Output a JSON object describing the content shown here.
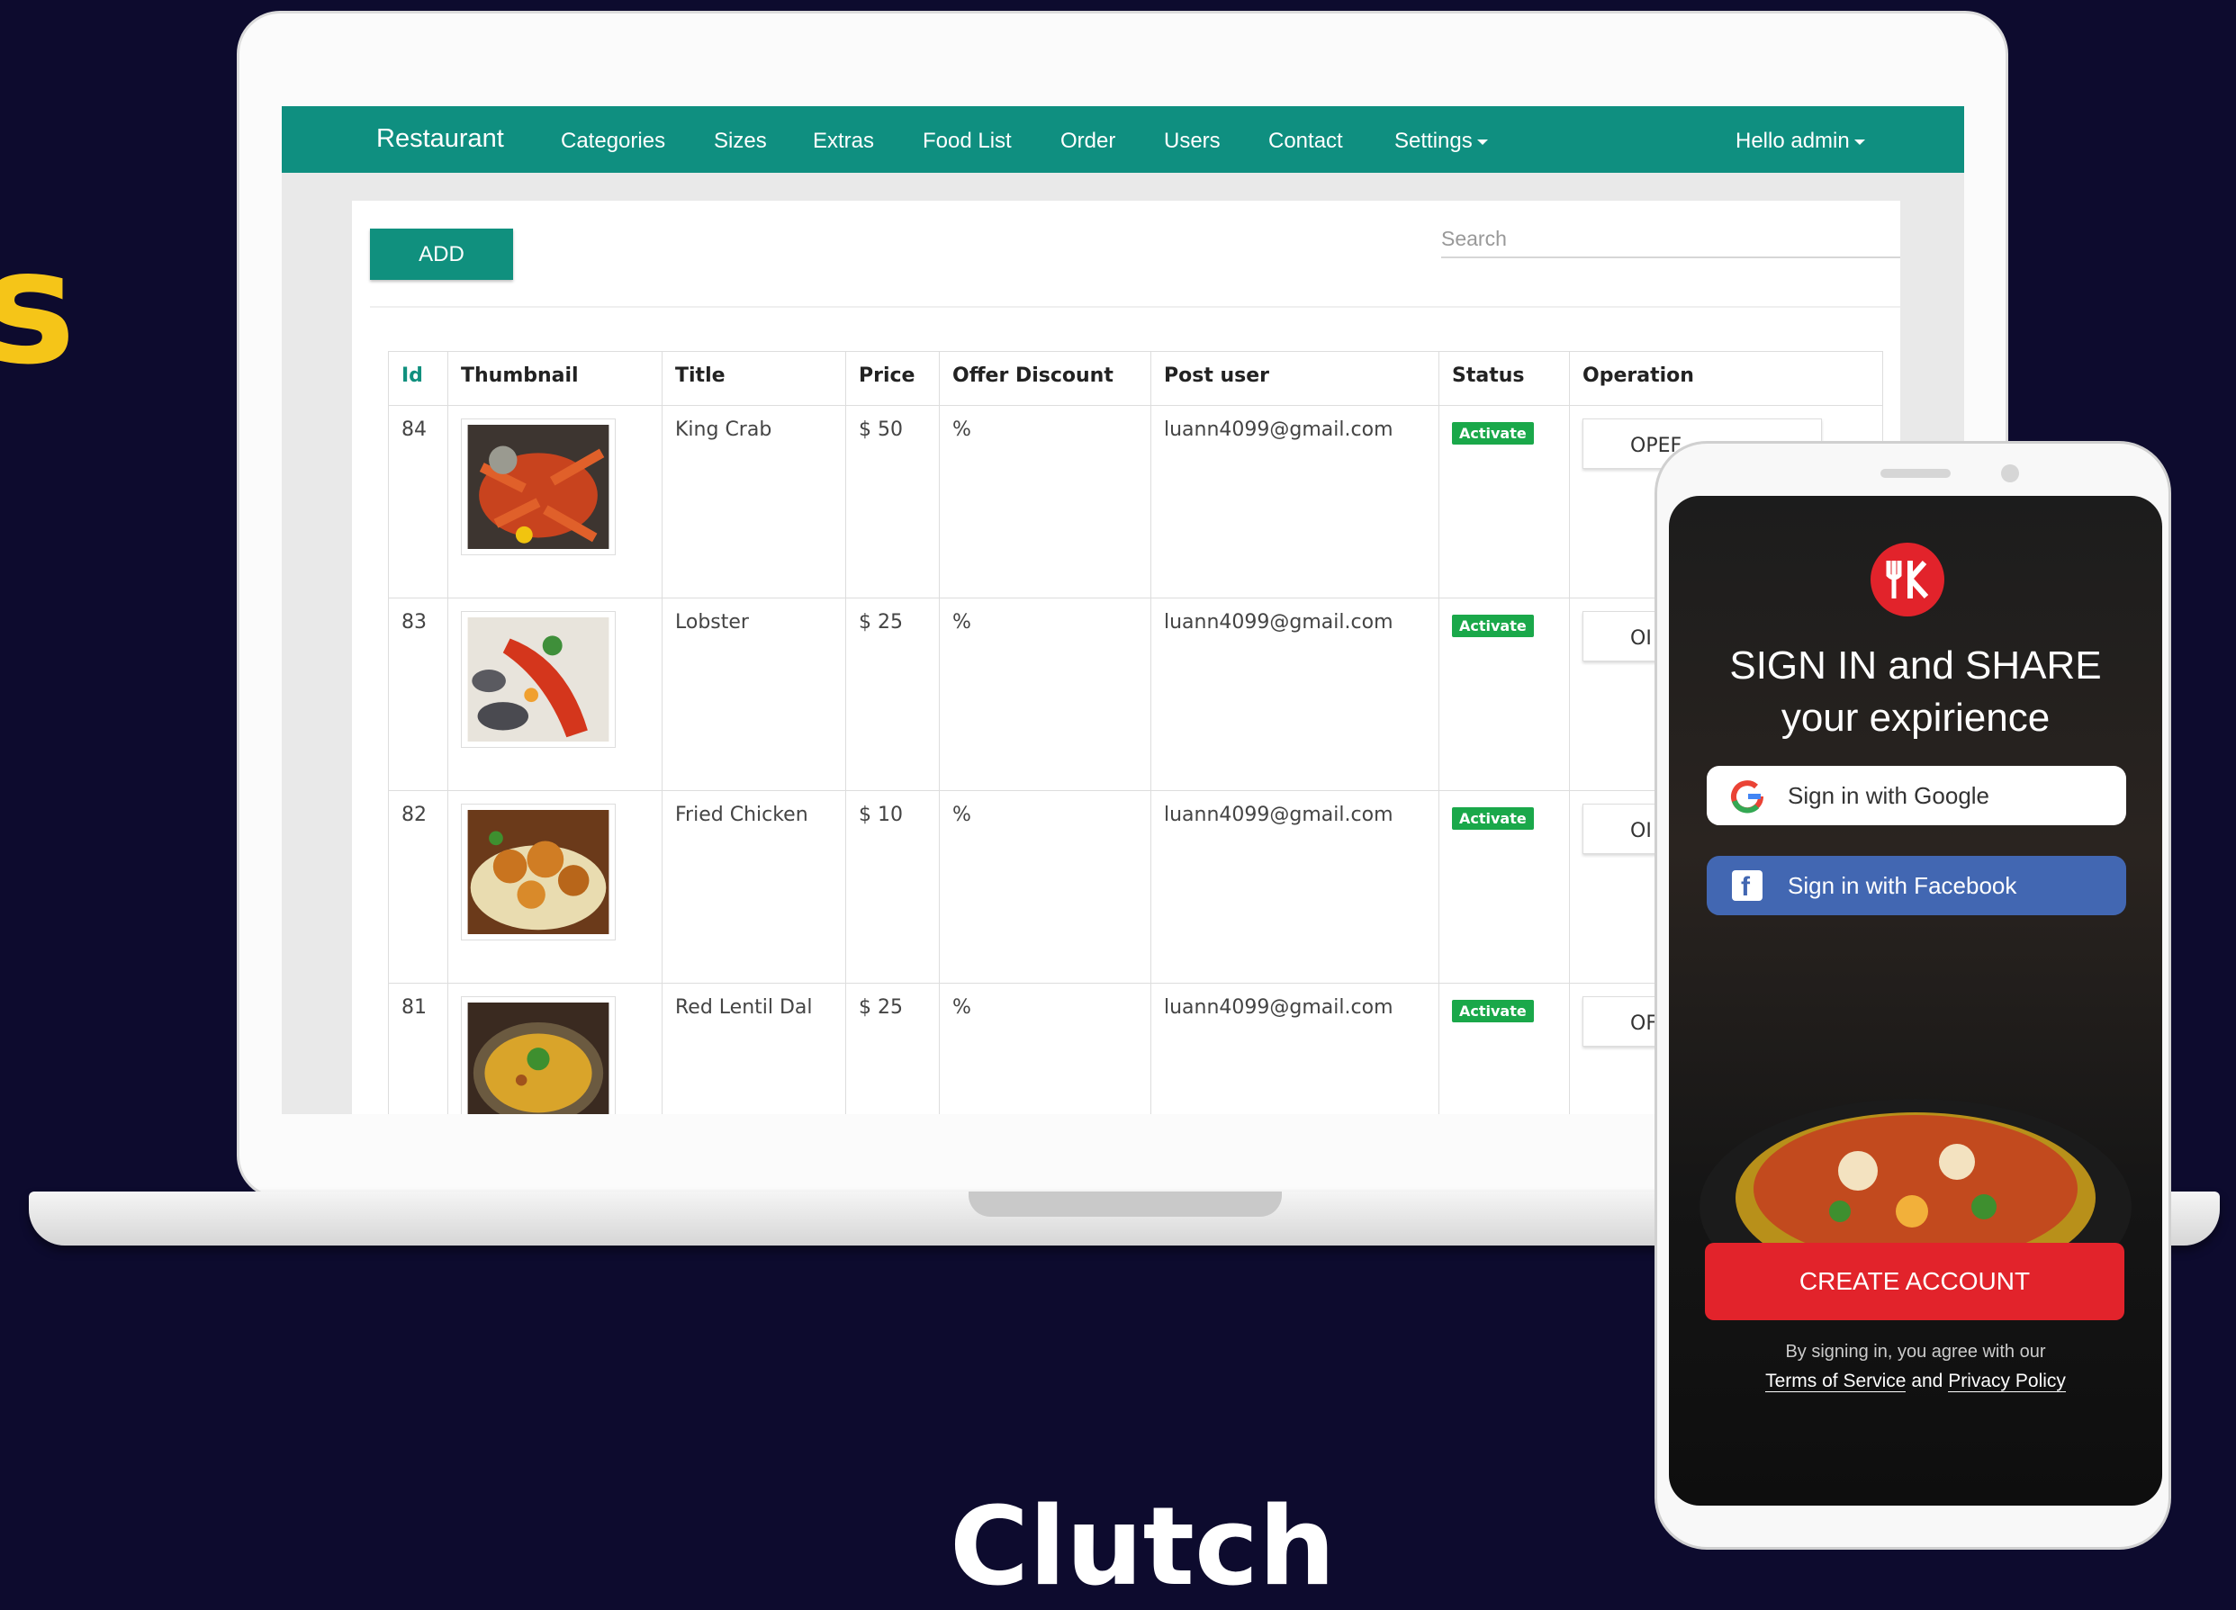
{
  "background": {
    "big_letter": "s",
    "footer_text": "Clutch"
  },
  "navbar": {
    "brand": "Restaurant",
    "items": [
      "Categories",
      "Sizes",
      "Extras",
      "Food List",
      "Order",
      "Users",
      "Contact",
      "Settings"
    ],
    "user_menu": "Hello admin"
  },
  "toolbar": {
    "add_label": "ADD",
    "search_placeholder": "Search"
  },
  "table": {
    "headers": [
      "Id",
      "Thumbnail",
      "Title",
      "Price",
      "Offer Discount",
      "Post user",
      "Status",
      "Operation"
    ],
    "rows": [
      {
        "id": "84",
        "title": "King Crab",
        "price": "$ 50",
        "discount": "%",
        "user": "luann4099@gmail.com",
        "status": "Activate",
        "operation": "OPEF"
      },
      {
        "id": "83",
        "title": "Lobster",
        "price": "$ 25",
        "discount": "%",
        "user": "luann4099@gmail.com",
        "status": "Activate",
        "operation": "OI"
      },
      {
        "id": "82",
        "title": "Fried Chicken",
        "price": "$ 10",
        "discount": "%",
        "user": "luann4099@gmail.com",
        "status": "Activate",
        "operation": "OI"
      },
      {
        "id": "81",
        "title": "Red Lentil Dal",
        "price": "$ 25",
        "discount": "%",
        "user": "luann4099@gmail.com",
        "status": "Activate",
        "operation": "OF"
      }
    ]
  },
  "mobile": {
    "title_line1": "SIGN IN and SHARE",
    "title_line2": "your expirience",
    "google_label": "Sign in with Google",
    "facebook_label": "Sign in with Facebook",
    "create_label": "CREATE ACCOUNT",
    "agree_text": "By signing in, you agree with our",
    "terms_link": "Terms of Service",
    "and_text": "and",
    "privacy_link": "Privacy Policy"
  },
  "colors": {
    "accent": "#10907e",
    "badge": "#1aa84a",
    "brand_red": "#e2232b",
    "facebook": "#4267b2",
    "background": "#0d0b2e",
    "highlight": "#f5c518"
  },
  "icons": [
    "google-icon",
    "facebook-icon",
    "restaurant-logo-icon",
    "caret-down-icon"
  ]
}
